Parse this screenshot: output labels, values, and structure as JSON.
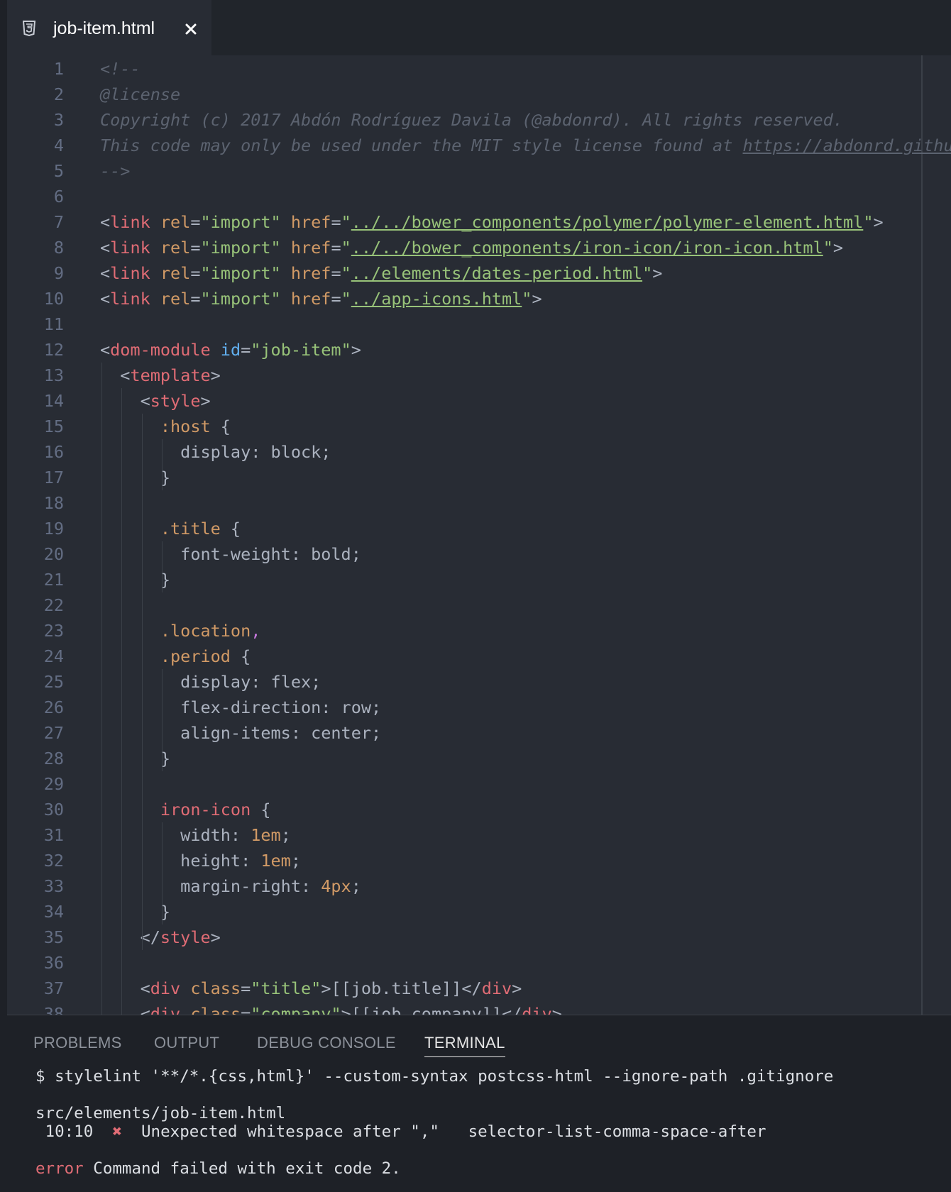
{
  "tab": {
    "file_icon": "html5-file-icon",
    "filename": "job-item.html",
    "close_icon": "close-icon"
  },
  "editor": {
    "lines": [
      {
        "n": "1",
        "tokens": [
          [
            "c-comment",
            "<!--"
          ]
        ]
      },
      {
        "n": "2",
        "tokens": [
          [
            "c-comment",
            "@license"
          ]
        ]
      },
      {
        "n": "3",
        "tokens": [
          [
            "c-comment",
            "Copyright (c) 2017 Abdón Rodríguez Davila (@abdonrd). All rights reserved."
          ]
        ]
      },
      {
        "n": "4",
        "tokens": [
          [
            "c-comment",
            "This code may only be used under the MIT style license found at "
          ],
          [
            "c-link-u",
            "https://abdonrd.github.io/LICENSE.txt"
          ]
        ]
      },
      {
        "n": "5",
        "tokens": [
          [
            "c-comment",
            "-->"
          ]
        ]
      },
      {
        "n": "6",
        "tokens": []
      },
      {
        "n": "7",
        "tokens": [
          [
            "c-pct",
            "<"
          ],
          [
            "c-tag",
            "link"
          ],
          [
            "c-pct",
            " "
          ],
          [
            "c-attr",
            "rel"
          ],
          [
            "c-pct",
            "="
          ],
          [
            "c-str",
            "\"import\""
          ],
          [
            "c-pct",
            " "
          ],
          [
            "c-attr",
            "href"
          ],
          [
            "c-pct",
            "="
          ],
          [
            "c-str",
            "\""
          ],
          [
            "c-url",
            "../../bower_components/polymer/polymer-element.html"
          ],
          [
            "c-str",
            "\""
          ],
          [
            "c-pct",
            ">"
          ]
        ]
      },
      {
        "n": "8",
        "tokens": [
          [
            "c-pct",
            "<"
          ],
          [
            "c-tag",
            "link"
          ],
          [
            "c-pct",
            " "
          ],
          [
            "c-attr",
            "rel"
          ],
          [
            "c-pct",
            "="
          ],
          [
            "c-str",
            "\"import\""
          ],
          [
            "c-pct",
            " "
          ],
          [
            "c-attr",
            "href"
          ],
          [
            "c-pct",
            "="
          ],
          [
            "c-str",
            "\""
          ],
          [
            "c-url",
            "../../bower_components/iron-icon/iron-icon.html"
          ],
          [
            "c-str",
            "\""
          ],
          [
            "c-pct",
            ">"
          ]
        ]
      },
      {
        "n": "9",
        "tokens": [
          [
            "c-pct",
            "<"
          ],
          [
            "c-tag",
            "link"
          ],
          [
            "c-pct",
            " "
          ],
          [
            "c-attr",
            "rel"
          ],
          [
            "c-pct",
            "="
          ],
          [
            "c-str",
            "\"import\""
          ],
          [
            "c-pct",
            " "
          ],
          [
            "c-attr",
            "href"
          ],
          [
            "c-pct",
            "="
          ],
          [
            "c-str",
            "\""
          ],
          [
            "c-url",
            "../elements/dates-period.html"
          ],
          [
            "c-str",
            "\""
          ],
          [
            "c-pct",
            ">"
          ]
        ]
      },
      {
        "n": "10",
        "tokens": [
          [
            "c-pct",
            "<"
          ],
          [
            "c-tag",
            "link"
          ],
          [
            "c-pct",
            " "
          ],
          [
            "c-attr",
            "rel"
          ],
          [
            "c-pct",
            "="
          ],
          [
            "c-str",
            "\"import\""
          ],
          [
            "c-pct",
            " "
          ],
          [
            "c-attr",
            "href"
          ],
          [
            "c-pct",
            "="
          ],
          [
            "c-str",
            "\""
          ],
          [
            "c-url",
            "../app-icons.html"
          ],
          [
            "c-str",
            "\""
          ],
          [
            "c-pct",
            ">"
          ]
        ]
      },
      {
        "n": "11",
        "tokens": []
      },
      {
        "n": "12",
        "tokens": [
          [
            "c-pct",
            "<"
          ],
          [
            "c-tag",
            "dom-module"
          ],
          [
            "c-pct",
            " "
          ],
          [
            "c-id",
            "id"
          ],
          [
            "c-pct",
            "="
          ],
          [
            "c-str",
            "\"job-item\""
          ],
          [
            "c-pct",
            ">"
          ]
        ]
      },
      {
        "n": "13",
        "tokens": [
          [
            "c-pct",
            "  <"
          ],
          [
            "c-tag",
            "template"
          ],
          [
            "c-pct",
            ">"
          ]
        ]
      },
      {
        "n": "14",
        "tokens": [
          [
            "c-pct",
            "    <"
          ],
          [
            "c-tag",
            "style"
          ],
          [
            "c-pct",
            ">"
          ]
        ]
      },
      {
        "n": "15",
        "tokens": [
          [
            "c-pct",
            "      "
          ],
          [
            "c-sel",
            ":host"
          ],
          [
            "c-pct",
            " {"
          ]
        ]
      },
      {
        "n": "16",
        "tokens": [
          [
            "c-pct",
            "        display: block;"
          ]
        ]
      },
      {
        "n": "17",
        "tokens": [
          [
            "c-pct",
            "      }"
          ]
        ]
      },
      {
        "n": "18",
        "tokens": []
      },
      {
        "n": "19",
        "tokens": [
          [
            "c-pct",
            "      "
          ],
          [
            "c-sel",
            ".title"
          ],
          [
            "c-pct",
            " {"
          ]
        ]
      },
      {
        "n": "20",
        "tokens": [
          [
            "c-pct",
            "        font-weight: bold;"
          ]
        ]
      },
      {
        "n": "21",
        "tokens": [
          [
            "c-pct",
            "      }"
          ]
        ]
      },
      {
        "n": "22",
        "tokens": []
      },
      {
        "n": "23",
        "tokens": [
          [
            "c-pct",
            "      "
          ],
          [
            "c-sel",
            ".location"
          ],
          [
            "c-comma",
            ","
          ]
        ]
      },
      {
        "n": "24",
        "tokens": [
          [
            "c-pct",
            "      "
          ],
          [
            "c-sel",
            ".period"
          ],
          [
            "c-pct",
            " {"
          ]
        ]
      },
      {
        "n": "25",
        "tokens": [
          [
            "c-pct",
            "        display: flex;"
          ]
        ]
      },
      {
        "n": "26",
        "tokens": [
          [
            "c-pct",
            "        flex-direction: row;"
          ]
        ]
      },
      {
        "n": "27",
        "tokens": [
          [
            "c-pct",
            "        align-items: center;"
          ]
        ]
      },
      {
        "n": "28",
        "tokens": [
          [
            "c-pct",
            "      }"
          ]
        ]
      },
      {
        "n": "29",
        "tokens": []
      },
      {
        "n": "30",
        "tokens": [
          [
            "c-pct",
            "      "
          ],
          [
            "c-tag",
            "iron-icon"
          ],
          [
            "c-pct",
            " {"
          ]
        ]
      },
      {
        "n": "31",
        "tokens": [
          [
            "c-pct",
            "        width: "
          ],
          [
            "c-num",
            "1em"
          ],
          [
            "c-pct",
            ";"
          ]
        ]
      },
      {
        "n": "32",
        "tokens": [
          [
            "c-pct",
            "        height: "
          ],
          [
            "c-num",
            "1em"
          ],
          [
            "c-pct",
            ";"
          ]
        ]
      },
      {
        "n": "33",
        "tokens": [
          [
            "c-pct",
            "        margin-right: "
          ],
          [
            "c-num",
            "4px"
          ],
          [
            "c-pct",
            ";"
          ]
        ]
      },
      {
        "n": "34",
        "tokens": [
          [
            "c-pct",
            "      }"
          ]
        ]
      },
      {
        "n": "35",
        "tokens": [
          [
            "c-pct",
            "    </"
          ],
          [
            "c-tag",
            "style"
          ],
          [
            "c-pct",
            ">"
          ]
        ]
      },
      {
        "n": "36",
        "tokens": []
      },
      {
        "n": "37",
        "tokens": [
          [
            "c-pct",
            "    <"
          ],
          [
            "c-tag",
            "div"
          ],
          [
            "c-pct",
            " "
          ],
          [
            "c-attr",
            "class"
          ],
          [
            "c-pct",
            "="
          ],
          [
            "c-str",
            "\"title\""
          ],
          [
            "c-pct",
            ">[[job.title]]</"
          ],
          [
            "c-tag",
            "div"
          ],
          [
            "c-pct",
            ">"
          ]
        ]
      },
      {
        "n": "38",
        "tokens": [
          [
            "c-pct",
            "    <"
          ],
          [
            "c-tag",
            "div"
          ],
          [
            "c-pct",
            " "
          ],
          [
            "c-attr",
            "class"
          ],
          [
            "c-pct",
            "="
          ],
          [
            "c-str",
            "\"company\""
          ],
          [
            "c-pct",
            ">[[job.company]]</"
          ],
          [
            "c-tag",
            "div"
          ],
          [
            "c-pct",
            ">"
          ]
        ]
      }
    ]
  },
  "panel": {
    "tabs": [
      {
        "label": "PROBLEMS",
        "active": false
      },
      {
        "label": "OUTPUT",
        "active": false
      },
      {
        "label": "DEBUG CONSOLE",
        "active": false
      },
      {
        "label": "TERMINAL",
        "active": true
      }
    ],
    "terminal": {
      "command": "$ stylelint '**/*.{css,html}' --custom-syntax postcss-html --ignore-path .gitignore",
      "file": "src/elements/job-item.html",
      "position": " 10:10",
      "error_icon": "error-x-icon",
      "error_glyph": "✖",
      "message": "Unexpected whitespace after \",\"",
      "rule": "selector-list-comma-space-after",
      "error_label": "error",
      "error_text": "Command failed with exit code 2."
    }
  },
  "colors": {
    "editor_bg": "#282c34",
    "panel_bg": "#1e2127",
    "tag": "#e06c75",
    "attr": "#d19a66",
    "string": "#98c379",
    "comment": "#5c6370",
    "id_attr": "#61afef",
    "comma": "#c678dd"
  }
}
